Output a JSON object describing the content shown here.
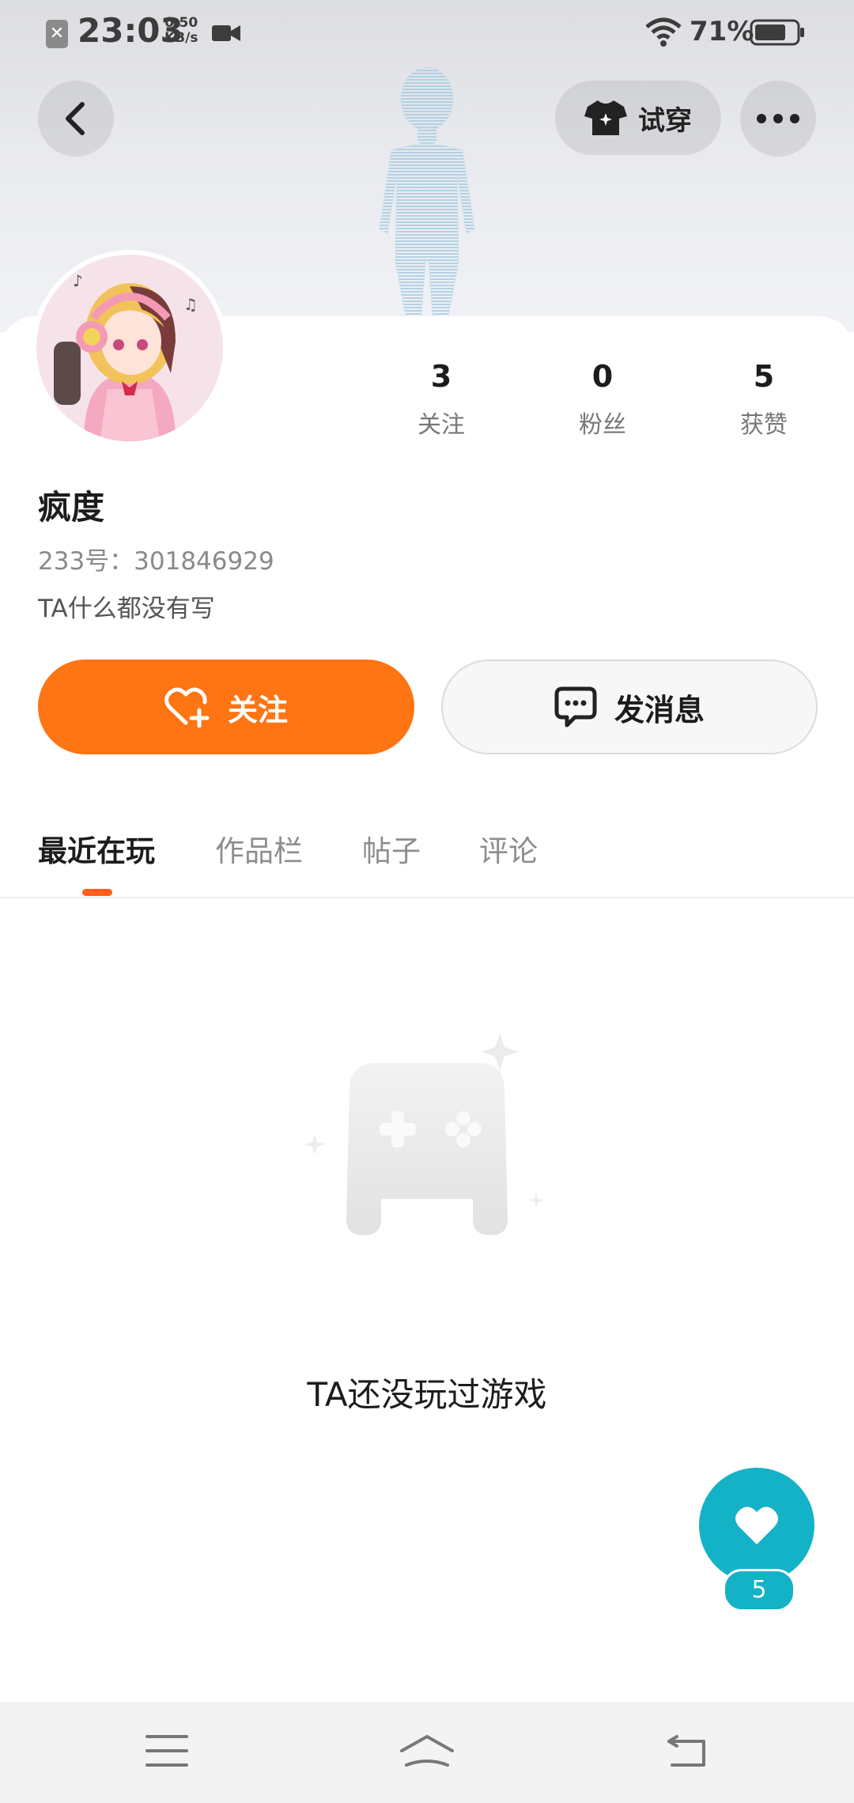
{
  "status_bar": {
    "time": "23:03",
    "net_speed_value": "0.50",
    "net_speed_unit": "KB/s",
    "battery": "71%"
  },
  "header": {
    "try_on_label": "试穿"
  },
  "profile": {
    "name": "疯度",
    "uid": "233号：301846929",
    "bio": "TA什么都没有写",
    "stats": [
      {
        "value": "3",
        "label": "关注"
      },
      {
        "value": "0",
        "label": "粉丝"
      },
      {
        "value": "5",
        "label": "获赞"
      }
    ]
  },
  "actions": {
    "follow_label": "关注",
    "message_label": "发消息"
  },
  "tabs": [
    {
      "label": "最近在玩",
      "active": true
    },
    {
      "label": "作品栏",
      "active": false
    },
    {
      "label": "帖子",
      "active": false
    },
    {
      "label": "评论",
      "active": false
    }
  ],
  "empty_state": {
    "text": "TA还没玩过游戏"
  },
  "like_fab": {
    "count": "5"
  },
  "colors": {
    "accent": "#ff7413",
    "like": "#13b2c6"
  }
}
